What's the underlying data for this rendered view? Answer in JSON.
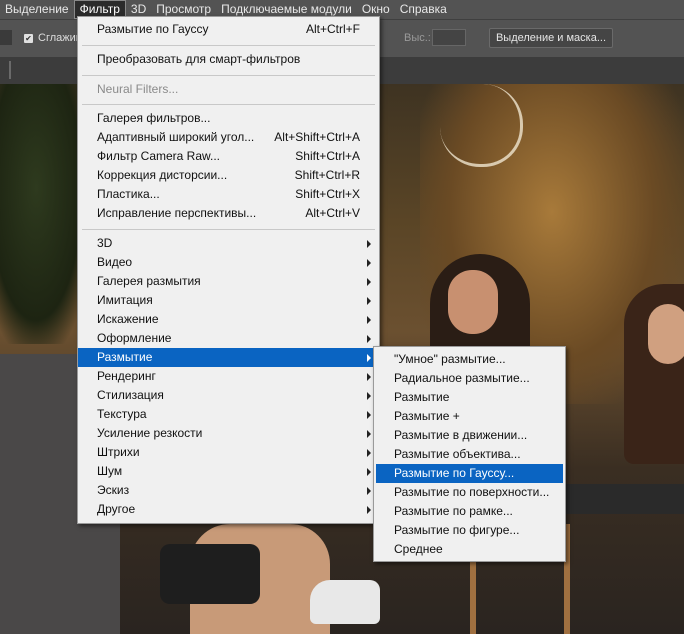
{
  "menubar": {
    "items": [
      "Выделение",
      "Фильтр",
      "3D",
      "Просмотр",
      "Подключаемые модули",
      "Окно",
      "Справка"
    ]
  },
  "options": {
    "smooth_label": "Сглажив",
    "height_label": "Выс.:",
    "select_mask_button": "Выделение и маска..."
  },
  "filter_menu": {
    "last_filter": {
      "label": "Размытие по Гауссу",
      "shortcut": "Alt+Ctrl+F"
    },
    "convert_smart": {
      "label": "Преобразовать для смарт-фильтров"
    },
    "neural": {
      "label": "Neural Filters..."
    },
    "gallery_group": [
      {
        "label": "Галерея фильтров...",
        "shortcut": ""
      },
      {
        "label": "Адаптивный широкий угол...",
        "shortcut": "Alt+Shift+Ctrl+A"
      },
      {
        "label": "Фильтр Camera Raw...",
        "shortcut": "Shift+Ctrl+A"
      },
      {
        "label": "Коррекция дисторсии...",
        "shortcut": "Shift+Ctrl+R"
      },
      {
        "label": "Пластика...",
        "shortcut": "Shift+Ctrl+X"
      },
      {
        "label": "Исправление перспективы...",
        "shortcut": "Alt+Ctrl+V"
      }
    ],
    "submenus": [
      {
        "label": "3D"
      },
      {
        "label": "Видео"
      },
      {
        "label": "Галерея размытия"
      },
      {
        "label": "Имитация"
      },
      {
        "label": "Искажение"
      },
      {
        "label": "Оформление"
      },
      {
        "label": "Размытие"
      },
      {
        "label": "Рендеринг"
      },
      {
        "label": "Стилизация"
      },
      {
        "label": "Текстура"
      },
      {
        "label": "Усиление резкости"
      },
      {
        "label": "Штрихи"
      },
      {
        "label": "Шум"
      },
      {
        "label": "Эскиз"
      },
      {
        "label": "Другое"
      }
    ]
  },
  "blur_submenu": {
    "items": [
      "\"Умное\" размытие...",
      "Радиальное размытие...",
      "Размытие",
      "Размытие +",
      "Размытие в движении...",
      "Размытие объектива...",
      "Размытие по Гауссу...",
      "Размытие по поверхности...",
      "Размытие по рамке...",
      "Размытие по фигуре...",
      "Среднее"
    ]
  },
  "colors": {
    "highlight": "#0a64c2",
    "menu_bg": "#f0f0f0",
    "chrome": "#535353"
  }
}
